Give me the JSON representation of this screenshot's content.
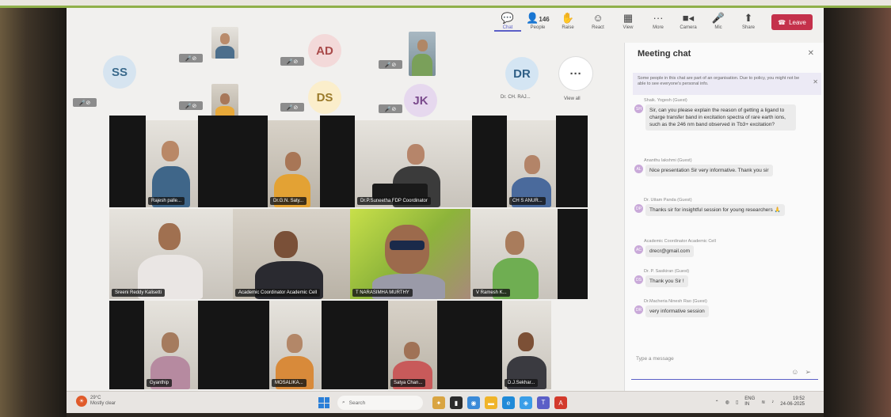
{
  "toolbar": {
    "chat": "Chat",
    "people": "People",
    "people_count": "146",
    "raise": "Raise",
    "react": "React",
    "view": "View",
    "more": "More",
    "camera": "Camera",
    "mic": "Mic",
    "share": "Share",
    "leave": "Leave"
  },
  "avatars": [
    {
      "initials": "SS",
      "color": "#d6e4f0",
      "text_color": "#3a6a8c"
    },
    {
      "initials": "AD",
      "color": "#f3d9d9",
      "text_color": "#a94a4a"
    },
    {
      "initials": "DS",
      "color": "#fbeecb",
      "text_color": "#9a7a2a"
    },
    {
      "initials": "JK",
      "color": "#e6d8ee",
      "text_color": "#7a4a8c"
    },
    {
      "initials": "DR",
      "color": "#d4e5f3",
      "text_color": "#2f5f86"
    }
  ],
  "top_strip": {
    "dr_caption": "Dr. CH. RAJ...",
    "view_all": "View all",
    "view_all_icon": "···"
  },
  "tiles": [
    {
      "label": "Rajesh palle..."
    },
    {
      "label": "Dr.G.N. Saty..."
    },
    {
      "label": "Dr.P.Suneetha FDP Coordinator"
    },
    {
      "label": "CH S ANUR..."
    },
    {
      "label": "Sreeni Reddy Kalisetti"
    },
    {
      "label": "Academic Coordinator Academic Cell"
    },
    {
      "label": "T NARASIMHA MURTHY"
    },
    {
      "label": "V Ramesh K..."
    },
    {
      "label": "Gyanthip"
    },
    {
      "label": "MOSALIKA..."
    },
    {
      "label": "Satya Chan..."
    },
    {
      "label": "D.J.Sekhar..."
    }
  ],
  "chat": {
    "title": "Meeting chat",
    "notice": "Some people in this chat are part of an organisation. Due to policy, you might not be able to see everyone's personal info.",
    "messages": [
      {
        "sender": "Shaik. Yogesh (Guest)",
        "initials": "SH",
        "text": "Sir, can you please explain the reason of getting a ligand to charge transfer band in excitation spectra of rare earth ions, such as the 246 nm band observed in Tb3+ excitation?"
      },
      {
        "sender": "Ananthu lakshmi (Guest)",
        "initials": "AL",
        "text": "Nice presentation Sir very informative. Thank you sir"
      },
      {
        "sender": "Dr. Uttam Panda (Guest)",
        "initials": "DP",
        "text": "Thanks sir for insightful session for young researchers 🙏"
      },
      {
        "sender": "Academic Coordinator Academic Cell",
        "initials": "AC",
        "text": "drecr@gmail.com"
      },
      {
        "sender": "Dr. P. Sasikiran (Guest)",
        "initials": "DS",
        "text": "Thank you Sir !"
      },
      {
        "sender": "Dr.Macheria Ninesh Rao (Guest)",
        "initials": "DR",
        "text": "very informative session"
      }
    ],
    "input_placeholder": "Type a message"
  },
  "taskbar": {
    "temp": "29°C",
    "weather": "Mostly clear",
    "search": "Search",
    "lang": "ENG",
    "lang_sub": "IN",
    "time": "19:52",
    "date": "24-06-2025"
  }
}
